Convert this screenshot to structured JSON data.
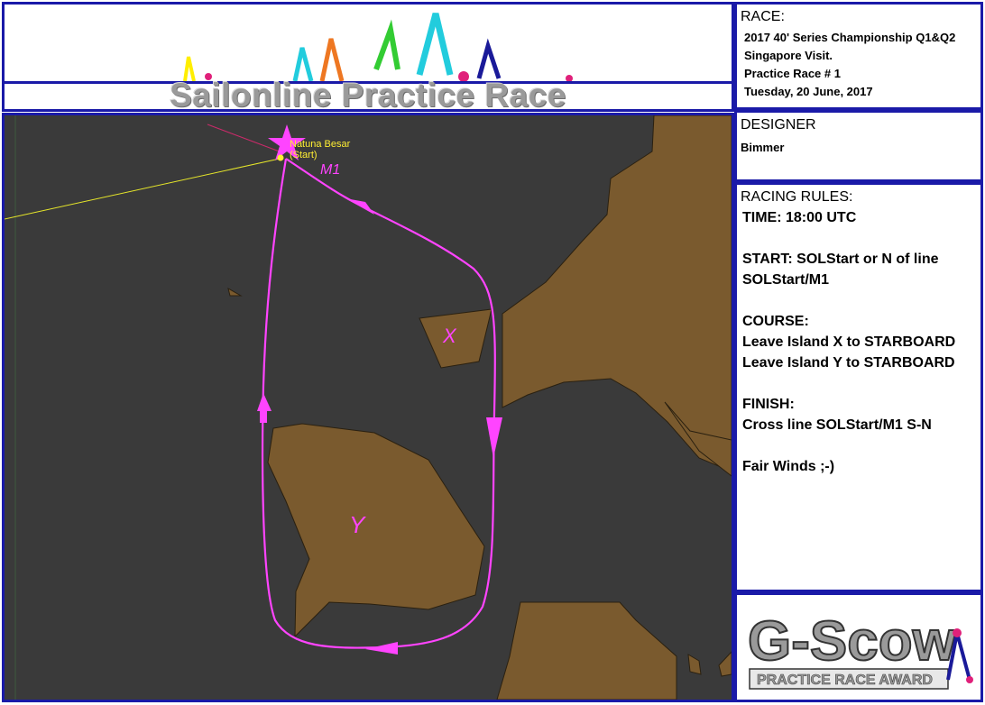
{
  "header": {
    "banner_title": "Sailonline Practice Race"
  },
  "race": {
    "heading": "RACE:",
    "lines": [
      "2017 40' Series Championship Q1&Q2",
      "Singapore Visit.",
      "Practice Race # 1",
      "Tuesday, 20 June, 2017"
    ]
  },
  "designer": {
    "heading": "DESIGNER",
    "name": "Bimmer"
  },
  "rules": {
    "heading": "RACING RULES:",
    "time": "TIME: 18:00 UTC",
    "start_1": "START: SOLStart or N of line",
    "start_2": "SOLStart/M1",
    "course_heading": "COURSE:",
    "course_1": "Leave Island X to STARBOARD",
    "course_2": "Leave Island Y to STARBOARD",
    "finish_heading": "FINISH:",
    "finish_1": "Cross line SOLStart/M1 S-N",
    "closing": "Fair Winds ;-)"
  },
  "map": {
    "start_label_1": "Natuna Besar",
    "start_label_2": "(Start)",
    "mark_label": "M1",
    "island_x_label": "X",
    "island_y_label": "Y"
  },
  "award": {
    "logo_text": "G-Scow",
    "subtitle": "PRACTICE RACE AWARD"
  },
  "colors": {
    "frame": "#1a1aa8",
    "sea": "#3a3a3a",
    "land": "#7a5a2e",
    "route": "#ff44ff",
    "start_line": "#e6e62a"
  }
}
